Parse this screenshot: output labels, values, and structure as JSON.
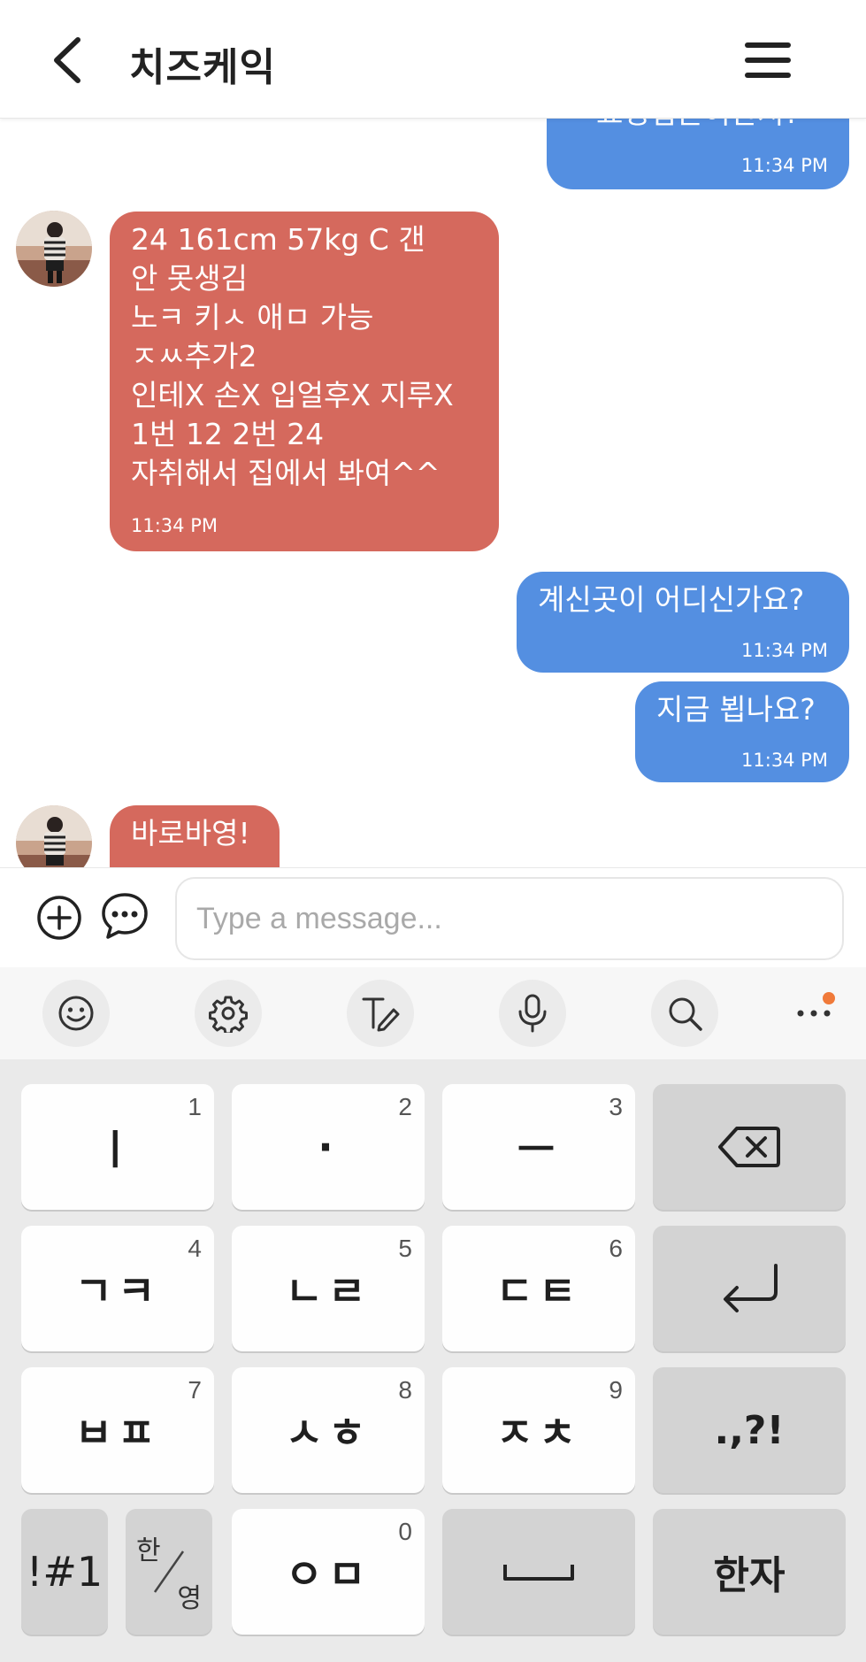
{
  "header": {
    "title": "치즈케익"
  },
  "messages": [
    {
      "dir": "out",
      "text": "표정입은어한지?",
      "time": "11:34 PM"
    },
    {
      "dir": "in",
      "text": "24 161cm 57kg C 갠\n안 못생김\n노ㅋ 키ㅅ 애ㅁ 가능\nㅈㅆ추가2\n인테X 손X 입얼후X 지루X\n1번 12 2번 24\n자취해서 집에서 봐여^^",
      "time": "11:34 PM"
    },
    {
      "dir": "out",
      "text": "계신곳이 어디신가요?",
      "time": "11:34 PM"
    },
    {
      "dir": "out",
      "text": "지금 뵙나요?",
      "time": "11:34 PM"
    },
    {
      "dir": "in",
      "text": "바로바영!",
      "time": ""
    }
  ],
  "input": {
    "placeholder": "Type a message..."
  },
  "toolbar": {
    "icons": [
      "emoji-icon",
      "settings-icon",
      "handwriting-icon",
      "mic-icon",
      "search-icon",
      "more-icon"
    ]
  },
  "keyboard": {
    "rows": [
      [
        {
          "label": "ㅣ",
          "num": "1"
        },
        {
          "label": "·",
          "num": "2"
        },
        {
          "label": "ㅡ",
          "num": "3"
        },
        {
          "label": "",
          "num": "",
          "icon": "backspace-icon"
        }
      ],
      [
        {
          "label": "ㄱㅋ",
          "num": "4"
        },
        {
          "label": "ㄴㄹ",
          "num": "5"
        },
        {
          "label": "ㄷㅌ",
          "num": "6"
        },
        {
          "label": "",
          "num": "",
          "icon": "enter-icon"
        }
      ],
      [
        {
          "label": "ㅂㅍ",
          "num": "7"
        },
        {
          "label": "ㅅㅎ",
          "num": "8"
        },
        {
          "label": "ㅈㅊ",
          "num": "9"
        },
        {
          "label": ".,?!",
          "num": ""
        }
      ],
      [
        {
          "label": "!#1",
          "num": ""
        },
        {
          "label_top": "한",
          "label_bottom": "영"
        },
        {
          "label": "ㅇㅁ",
          "num": "0"
        },
        {
          "label": "",
          "icon": "space-icon"
        },
        {
          "label": "한자",
          "num": ""
        }
      ]
    ]
  }
}
